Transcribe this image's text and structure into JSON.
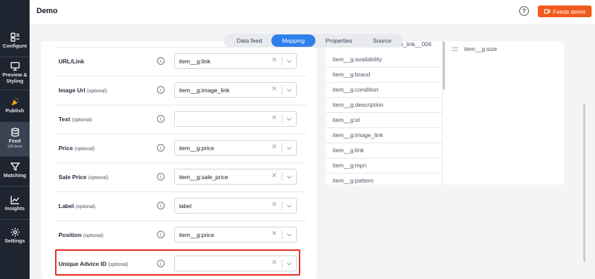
{
  "app": {
    "title": "Demo"
  },
  "header": {
    "help_glyph": "?",
    "feeds_button": "Feeds demo"
  },
  "sidebar": {
    "items": [
      {
        "label": "Configure",
        "icon": "configure-icon"
      },
      {
        "label": "Preview & Styling",
        "icon": "monitor-icon"
      },
      {
        "label": "Publish",
        "icon": "party-popper-icon"
      },
      {
        "label": "Feed",
        "sub": "128 items",
        "icon": "database-icon",
        "active": true
      },
      {
        "label": "Matching",
        "icon": "filter-icon"
      },
      {
        "label": "Insights",
        "icon": "chart-icon"
      },
      {
        "label": "Settings",
        "icon": "gear-icon"
      }
    ]
  },
  "tabs": [
    {
      "label": "Data feed"
    },
    {
      "label": "Mapping",
      "active": true
    },
    {
      "label": "Properties"
    },
    {
      "label": "Source"
    }
  ],
  "mapping": {
    "optional_text": "(optional)",
    "clear_glyph": "✕",
    "info_glyph": "i",
    "rows": [
      {
        "label": "URL/Link",
        "optional": false,
        "value": "item__g:link"
      },
      {
        "label": "Image Url",
        "optional": true,
        "value": "item__g:image_link"
      },
      {
        "label": "Text",
        "optional": true,
        "value": ""
      },
      {
        "label": "Price",
        "optional": true,
        "value": "item__g:price"
      },
      {
        "label": "Sale Price",
        "optional": true,
        "value": "item__g:sale_price"
      },
      {
        "label": "Label",
        "optional": true,
        "value": "label"
      },
      {
        "label": "Position",
        "optional": true,
        "value": "item__g:price"
      },
      {
        "label": "Unique Advice ID",
        "optional": true,
        "value": ""
      }
    ]
  },
  "source_fields": {
    "partial": "ge_link__006",
    "items": [
      "item__g:availability",
      "item__g:brand",
      "item__g:condition",
      "item__g:description",
      "item__g:id",
      "item__g:image_link",
      "item__g:link",
      "item__g:mpn",
      "item__g:pattern"
    ]
  },
  "target_field": "item__g:size",
  "colors": {
    "sidebar": "#1e2530",
    "accent_orange": "#f05a1a",
    "tab_active": "#2f80ed",
    "highlight": "#e3261b"
  }
}
